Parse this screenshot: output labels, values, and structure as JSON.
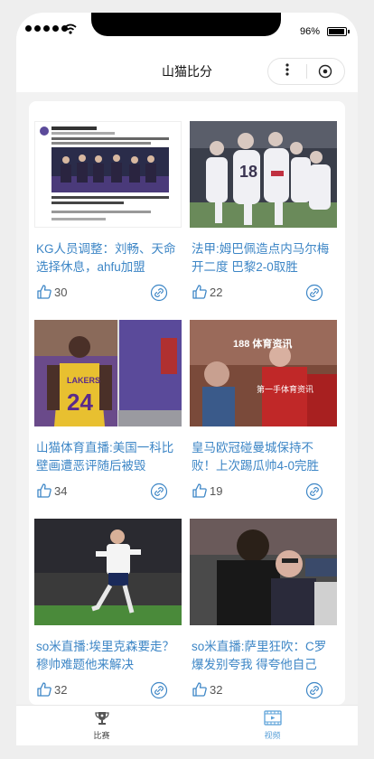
{
  "status_bar": {
    "battery": "96%"
  },
  "nav": {
    "title": "山猫比分",
    "more_label": "•••"
  },
  "feed": [
    {
      "title": "KG人员调整：刘畅、天命选择休息，ahfu加盟",
      "likes": "30",
      "thumb": "esports-screenshot"
    },
    {
      "title": "法甲:姆巴佩造点内马尔梅开二度 巴黎2-0取胜",
      "likes": "22",
      "thumb": "psg-celebration"
    },
    {
      "title": "山猫体育直播:美国一科比壁画遭恶评随后被毁",
      "likes": "34",
      "thumb": "kobe-mural"
    },
    {
      "title": "皇马欧冠碰曼城保持不败！上次踢瓜帅4-0完胜",
      "likes": "19",
      "thumb": "football-photo"
    },
    {
      "title": "so米直播:埃里克森要走？穆帅难题他来解决",
      "likes": "32",
      "thumb": "tottenham-player"
    },
    {
      "title": "so米直播:萨里狂吹：C罗爆发别夸我 得夸他自己",
      "likes": "32",
      "thumb": "sarri-hug"
    }
  ],
  "esports_thumb": {
    "account": "KG电子竞技俱乐部",
    "headline": "【KG电子竞技俱乐部DOTA2分部人员调整公告】",
    "team_tag": "KG电子竞技俱乐部"
  },
  "football_thumb": {
    "watermark": "188 体育资讯",
    "sub_watermark": "第一手体育资讯"
  },
  "tabs": [
    {
      "label": "比赛",
      "icon": "trophy-icon"
    },
    {
      "label": "视频",
      "icon": "video-icon"
    }
  ],
  "colors": {
    "accent": "#3d86c6",
    "tab_active": "#5aa0d8"
  }
}
